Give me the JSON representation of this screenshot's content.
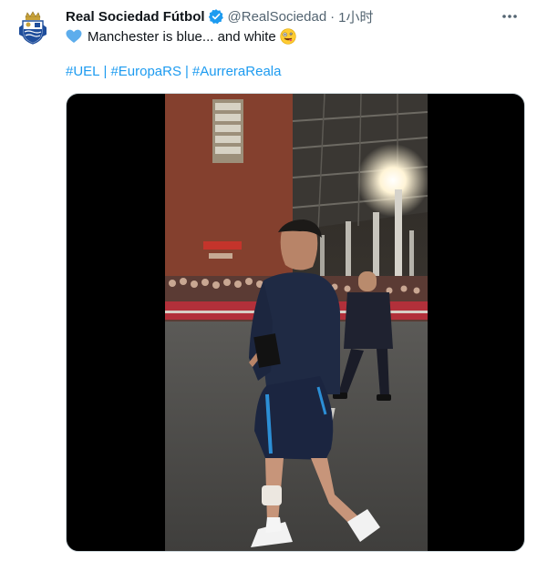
{
  "tweet": {
    "display_name": "Real Sociedad Fútbol",
    "handle": "@RealSociedad",
    "separator": "·",
    "time": "1小时",
    "text": "Manchester is blue... and white",
    "hashtags": [
      "#UEL",
      "#EuropaRS",
      "#AurreraReala"
    ],
    "hashtag_separator": "|"
  },
  "icons": {
    "avatar": "real-sociedad-crest-icon",
    "verified": "verified-badge-icon",
    "more": "more-options-icon",
    "heart": "blue-heart-emoji-icon",
    "emoji": "zany-face-emoji-icon"
  },
  "colors": {
    "link": "#1d9bf0",
    "secondary_text": "#536471",
    "verified": "#1d9bf0",
    "media_background": "#000000"
  }
}
